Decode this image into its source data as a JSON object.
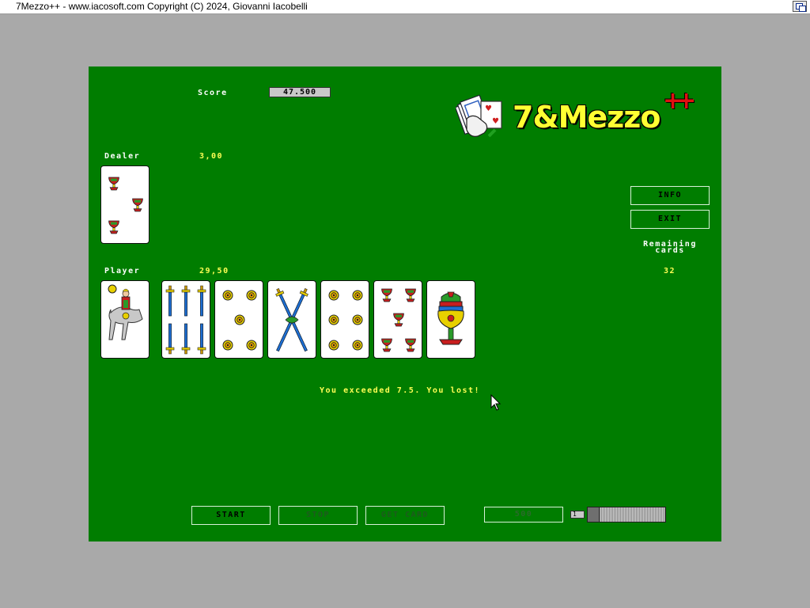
{
  "window": {
    "title": "7Mezzo++ - www.iacosoft.com Copyright (C) 2024, Giovanni Iacobelli"
  },
  "colors": {
    "board": "#007d00",
    "value_text": "#ffff55",
    "label_text": "#ffffff",
    "coins": "#e8d000",
    "cups": "#c81e1e",
    "swords": "#1e6ed2"
  },
  "score": {
    "label": "Score",
    "value": "47.500"
  },
  "logo": {
    "text": "7&Mezzo",
    "plus": "++"
  },
  "dealer": {
    "label": "Dealer",
    "points": "3,00",
    "cards": [
      {
        "rank": 3,
        "suit": "cups"
      }
    ]
  },
  "player": {
    "label": "Player",
    "points": "29,50",
    "cards": [
      {
        "rank": "knight",
        "suit": "coins"
      },
      {
        "rank": 6,
        "suit": "swords"
      },
      {
        "rank": 5,
        "suit": "coins"
      },
      {
        "rank": 2,
        "suit": "swords"
      },
      {
        "rank": 6,
        "suit": "coins"
      },
      {
        "rank": 5,
        "suit": "cups"
      },
      {
        "rank": 1,
        "suit": "cups"
      }
    ]
  },
  "side": {
    "info_label": "INFO",
    "exit_label": "EXIT",
    "remaining_label_1": "Remaining",
    "remaining_label_2": "cards",
    "remaining_value": "32"
  },
  "message": "You exceeded 7.5. You lost!",
  "controls": {
    "start_label": "START",
    "stop_label": "STOP",
    "get_card_label": "GET CARD",
    "bet_value": "500",
    "spin_value": "1"
  }
}
